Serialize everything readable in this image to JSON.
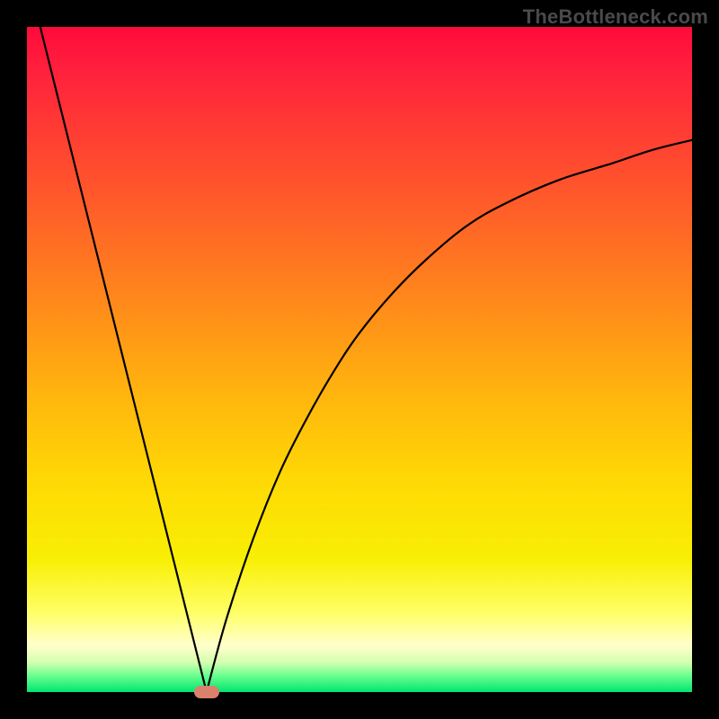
{
  "watermark": {
    "text": "TheBottleneck.com"
  },
  "colors": {
    "border": "#000000",
    "curve": "#000000",
    "marker": "#d9816b",
    "gradient_stops": [
      {
        "offset": 0.0,
        "color": "#ff0a3a"
      },
      {
        "offset": 0.06,
        "color": "#ff1f3d"
      },
      {
        "offset": 0.15,
        "color": "#ff3a34"
      },
      {
        "offset": 0.28,
        "color": "#ff6028"
      },
      {
        "offset": 0.42,
        "color": "#ff8b1a"
      },
      {
        "offset": 0.55,
        "color": "#ffb40e"
      },
      {
        "offset": 0.68,
        "color": "#ffd805"
      },
      {
        "offset": 0.8,
        "color": "#f8ef04"
      },
      {
        "offset": 0.88,
        "color": "#ffff66"
      },
      {
        "offset": 0.93,
        "color": "#ffffcc"
      },
      {
        "offset": 0.955,
        "color": "#d6ffb0"
      },
      {
        "offset": 0.975,
        "color": "#6cff8f"
      },
      {
        "offset": 1.0,
        "color": "#00e670"
      }
    ]
  },
  "chart_data": {
    "type": "line",
    "title": "",
    "xlabel": "",
    "ylabel": "",
    "xlim": [
      0,
      100
    ],
    "ylim": [
      0,
      100
    ],
    "grid": false,
    "legend": false,
    "annotations": [
      {
        "name": "minimum-marker",
        "x": 27,
        "y": 0,
        "shape": "rounded-rect"
      }
    ],
    "note": "V-shaped curve with cusp near x≈27, y≈0; left branch nearly vertical to y≈100 at x≈2; right branch rises concave toward y≈83 at x≈100. Values estimated from pixels.",
    "series": [
      {
        "name": "curve-left",
        "x": [
          2,
          5,
          8,
          11,
          14,
          17,
          20,
          23,
          26,
          27
        ],
        "values": [
          100,
          88,
          76,
          64,
          52,
          40,
          28,
          16,
          4,
          0
        ]
      },
      {
        "name": "curve-right",
        "x": [
          27,
          30,
          34,
          38,
          42,
          46,
          50,
          55,
          60,
          66,
          72,
          80,
          88,
          94,
          100
        ],
        "values": [
          0,
          11,
          23,
          33,
          41,
          48,
          54,
          60,
          65,
          70,
          73.5,
          77,
          79.5,
          81.5,
          83
        ]
      }
    ]
  }
}
